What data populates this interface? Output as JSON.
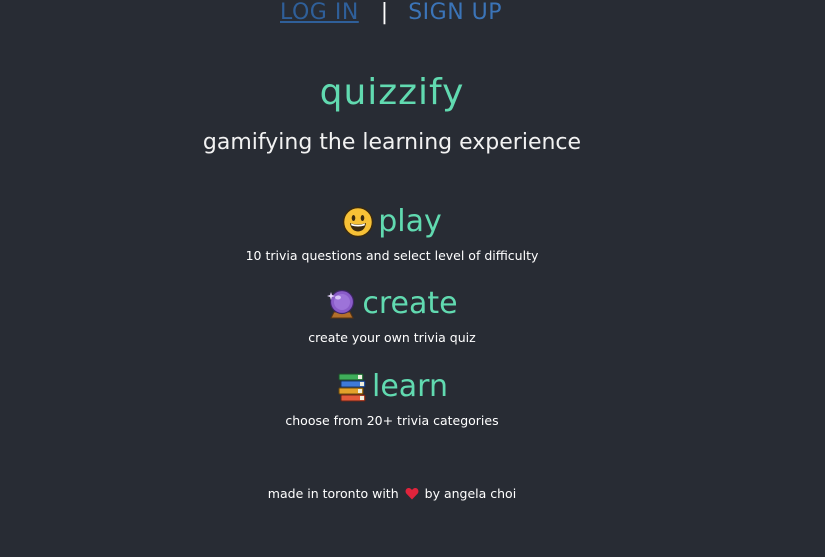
{
  "nav": {
    "login_label": "LOG IN",
    "separator": "|",
    "signup_label": "SIGN UP"
  },
  "brand": {
    "title": "quizzify",
    "tagline": "gamifying the learning experience"
  },
  "features": [
    {
      "icon": "grinning-face-icon",
      "title": "play",
      "description": "10 trivia questions and select level of difficulty"
    },
    {
      "icon": "crystal-ball-icon",
      "title": "create",
      "description": "create your own trivia quiz"
    },
    {
      "icon": "books-icon",
      "title": "learn",
      "description": "choose from 20+ trivia categories"
    }
  ],
  "footer": {
    "prefix": "made in toronto with",
    "heart_icon": "heart-icon",
    "suffix": "by angela choi"
  },
  "colors": {
    "background": "#282c34",
    "accent": "#61dab0",
    "nav_link": "#3b74b8",
    "heart": "#e0243c"
  }
}
